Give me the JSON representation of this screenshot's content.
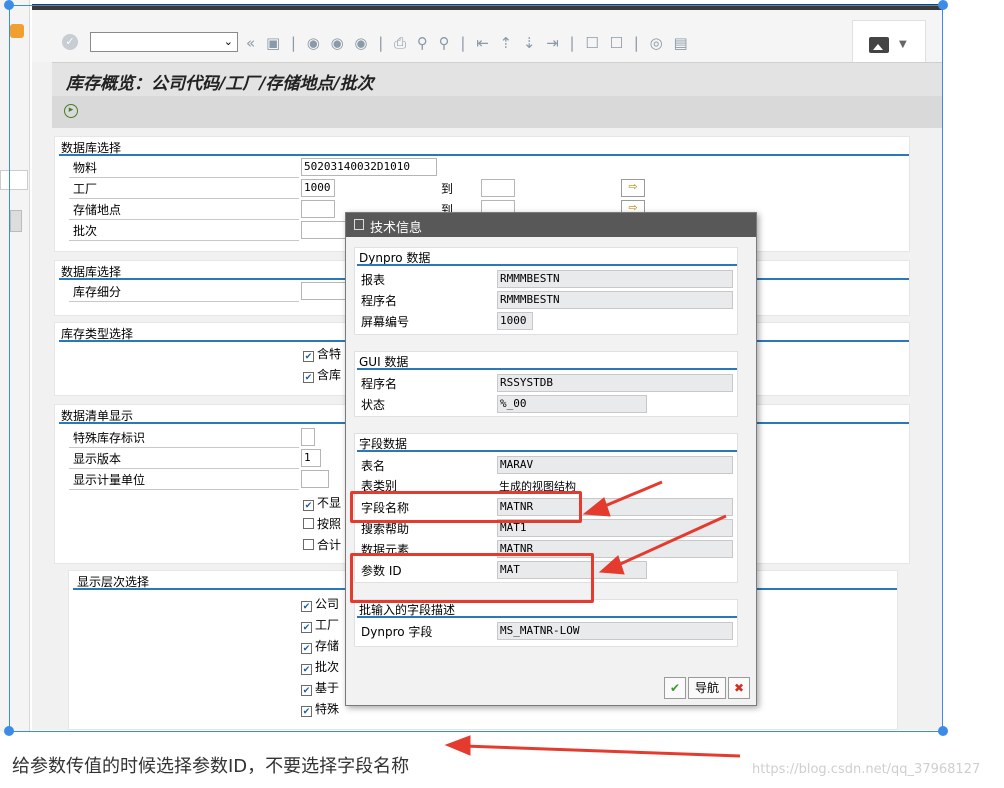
{
  "toolbar": {
    "command_field": "",
    "icons": "« ▣ | ◉ ◉ ◉ | ⎙ ⚲ ⚲ | ⇤ ⇡ ⇣ ⇥ | ☐ ☐ | ◎ ▤"
  },
  "screen_title": "库存概览：公司代码/工厂/存储地点/批次",
  "sections": {
    "db_select_1": {
      "title": "数据库选择",
      "material_label": "物料",
      "material_value": "50203140032D1010",
      "plant_label": "工厂",
      "plant_value": "1000",
      "to_label_1": "到",
      "sloc_label": "存储地点",
      "to_label_2": "到",
      "batch_label": "批次"
    },
    "db_select_2": {
      "title": "数据库选择",
      "stock_detail_label": "库存细分"
    },
    "stock_type": {
      "title": "库存类型选择",
      "cb1": "含特",
      "cb2": "含库"
    },
    "list_display": {
      "title": "数据清单显示",
      "special_stock_label": "特殊库存标识",
      "version_label": "显示版本",
      "version_value": "1",
      "unit_label": "显示计量单位",
      "cb1": "不显",
      "cb2": "按照",
      "cb3": "合计"
    },
    "hierarchy": {
      "title": "显示层次选择",
      "items": [
        "公司",
        "工厂",
        "存储",
        "批次",
        "基于",
        "特殊"
      ]
    }
  },
  "popup": {
    "title": "技术信息",
    "dynpro_group": "Dynpro 数据",
    "report_label": "报表",
    "report_value": "RMMMBESTN",
    "program_label": "程序名",
    "program_value": "RMMMBESTN",
    "screen_label": "屏幕编号",
    "screen_value": "1000",
    "gui_group": "GUI 数据",
    "gui_program_label": "程序名",
    "gui_program_value": "RSSYSTDB",
    "status_label": "状态",
    "status_value": "%_00",
    "field_group": "字段数据",
    "table_label": "表名",
    "table_value": "MARAV",
    "table_type_label": "表类别",
    "table_type_value": "生成的视图结构",
    "field_name_label": "字段名称",
    "field_name_value": "MATNR",
    "search_help_label": "搜索帮助",
    "search_help_value": "MAT1",
    "data_element_label": "数据元素",
    "data_element_value": "MATNR",
    "param_id_label": "参数 ID",
    "param_id_value": "MAT",
    "batch_input_group": "批输入的字段描述",
    "dynpro_field_label": "Dynpro 字段",
    "dynpro_field_value": "MS_MATNR-LOW",
    "ok_icon": "✔",
    "nav_label": "导航",
    "cancel_icon": "✖"
  },
  "caption": "给参数传值的时候选择参数ID，不要选择字段名称",
  "watermark": "https://blog.csdn.net/qq_37968127",
  "colors": {
    "highlight": "#e53b2e",
    "section_line": "#2a78b8",
    "popup_header": "#585858"
  }
}
